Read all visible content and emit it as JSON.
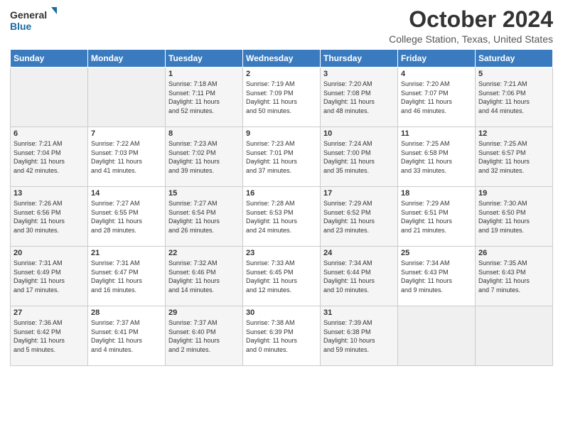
{
  "header": {
    "logo_line1": "General",
    "logo_line2": "Blue",
    "month": "October 2024",
    "location": "College Station, Texas, United States"
  },
  "weekdays": [
    "Sunday",
    "Monday",
    "Tuesday",
    "Wednesday",
    "Thursday",
    "Friday",
    "Saturday"
  ],
  "weeks": [
    [
      {
        "day": "",
        "info": ""
      },
      {
        "day": "",
        "info": ""
      },
      {
        "day": "1",
        "info": "Sunrise: 7:18 AM\nSunset: 7:11 PM\nDaylight: 11 hours\nand 52 minutes."
      },
      {
        "day": "2",
        "info": "Sunrise: 7:19 AM\nSunset: 7:09 PM\nDaylight: 11 hours\nand 50 minutes."
      },
      {
        "day": "3",
        "info": "Sunrise: 7:20 AM\nSunset: 7:08 PM\nDaylight: 11 hours\nand 48 minutes."
      },
      {
        "day": "4",
        "info": "Sunrise: 7:20 AM\nSunset: 7:07 PM\nDaylight: 11 hours\nand 46 minutes."
      },
      {
        "day": "5",
        "info": "Sunrise: 7:21 AM\nSunset: 7:06 PM\nDaylight: 11 hours\nand 44 minutes."
      }
    ],
    [
      {
        "day": "6",
        "info": "Sunrise: 7:21 AM\nSunset: 7:04 PM\nDaylight: 11 hours\nand 42 minutes."
      },
      {
        "day": "7",
        "info": "Sunrise: 7:22 AM\nSunset: 7:03 PM\nDaylight: 11 hours\nand 41 minutes."
      },
      {
        "day": "8",
        "info": "Sunrise: 7:23 AM\nSunset: 7:02 PM\nDaylight: 11 hours\nand 39 minutes."
      },
      {
        "day": "9",
        "info": "Sunrise: 7:23 AM\nSunset: 7:01 PM\nDaylight: 11 hours\nand 37 minutes."
      },
      {
        "day": "10",
        "info": "Sunrise: 7:24 AM\nSunset: 7:00 PM\nDaylight: 11 hours\nand 35 minutes."
      },
      {
        "day": "11",
        "info": "Sunrise: 7:25 AM\nSunset: 6:58 PM\nDaylight: 11 hours\nand 33 minutes."
      },
      {
        "day": "12",
        "info": "Sunrise: 7:25 AM\nSunset: 6:57 PM\nDaylight: 11 hours\nand 32 minutes."
      }
    ],
    [
      {
        "day": "13",
        "info": "Sunrise: 7:26 AM\nSunset: 6:56 PM\nDaylight: 11 hours\nand 30 minutes."
      },
      {
        "day": "14",
        "info": "Sunrise: 7:27 AM\nSunset: 6:55 PM\nDaylight: 11 hours\nand 28 minutes."
      },
      {
        "day": "15",
        "info": "Sunrise: 7:27 AM\nSunset: 6:54 PM\nDaylight: 11 hours\nand 26 minutes."
      },
      {
        "day": "16",
        "info": "Sunrise: 7:28 AM\nSunset: 6:53 PM\nDaylight: 11 hours\nand 24 minutes."
      },
      {
        "day": "17",
        "info": "Sunrise: 7:29 AM\nSunset: 6:52 PM\nDaylight: 11 hours\nand 23 minutes."
      },
      {
        "day": "18",
        "info": "Sunrise: 7:29 AM\nSunset: 6:51 PM\nDaylight: 11 hours\nand 21 minutes."
      },
      {
        "day": "19",
        "info": "Sunrise: 7:30 AM\nSunset: 6:50 PM\nDaylight: 11 hours\nand 19 minutes."
      }
    ],
    [
      {
        "day": "20",
        "info": "Sunrise: 7:31 AM\nSunset: 6:49 PM\nDaylight: 11 hours\nand 17 minutes."
      },
      {
        "day": "21",
        "info": "Sunrise: 7:31 AM\nSunset: 6:47 PM\nDaylight: 11 hours\nand 16 minutes."
      },
      {
        "day": "22",
        "info": "Sunrise: 7:32 AM\nSunset: 6:46 PM\nDaylight: 11 hours\nand 14 minutes."
      },
      {
        "day": "23",
        "info": "Sunrise: 7:33 AM\nSunset: 6:45 PM\nDaylight: 11 hours\nand 12 minutes."
      },
      {
        "day": "24",
        "info": "Sunrise: 7:34 AM\nSunset: 6:44 PM\nDaylight: 11 hours\nand 10 minutes."
      },
      {
        "day": "25",
        "info": "Sunrise: 7:34 AM\nSunset: 6:43 PM\nDaylight: 11 hours\nand 9 minutes."
      },
      {
        "day": "26",
        "info": "Sunrise: 7:35 AM\nSunset: 6:43 PM\nDaylight: 11 hours\nand 7 minutes."
      }
    ],
    [
      {
        "day": "27",
        "info": "Sunrise: 7:36 AM\nSunset: 6:42 PM\nDaylight: 11 hours\nand 5 minutes."
      },
      {
        "day": "28",
        "info": "Sunrise: 7:37 AM\nSunset: 6:41 PM\nDaylight: 11 hours\nand 4 minutes."
      },
      {
        "day": "29",
        "info": "Sunrise: 7:37 AM\nSunset: 6:40 PM\nDaylight: 11 hours\nand 2 minutes."
      },
      {
        "day": "30",
        "info": "Sunrise: 7:38 AM\nSunset: 6:39 PM\nDaylight: 11 hours\nand 0 minutes."
      },
      {
        "day": "31",
        "info": "Sunrise: 7:39 AM\nSunset: 6:38 PM\nDaylight: 10 hours\nand 59 minutes."
      },
      {
        "day": "",
        "info": ""
      },
      {
        "day": "",
        "info": ""
      }
    ]
  ]
}
